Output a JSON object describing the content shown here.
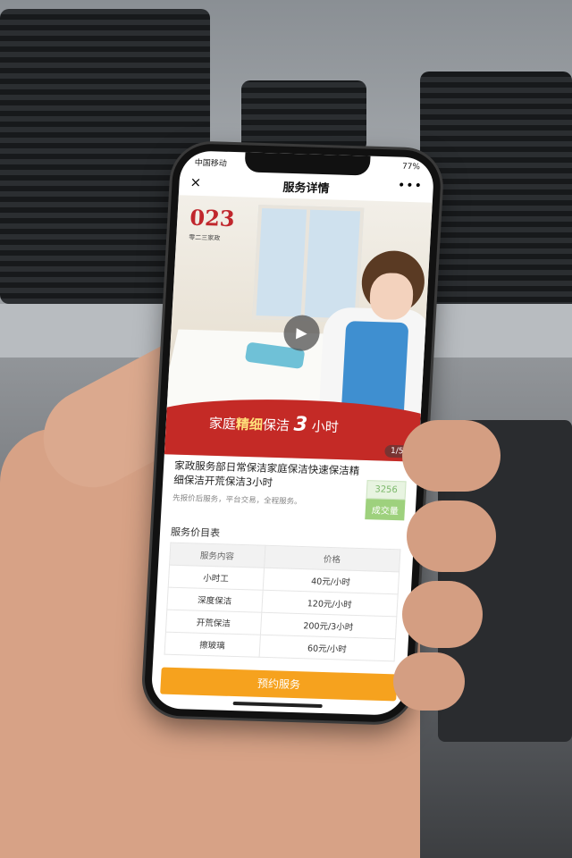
{
  "status_bar": {
    "carrier": "中国移动",
    "battery": "77%"
  },
  "nav": {
    "close_icon": "×",
    "title": "服务详情",
    "more_icon": "•••"
  },
  "banner": {
    "logo_text": "023",
    "logo_sub": "零二三家政",
    "slogan": {
      "part1": "家庭",
      "part2": "精细",
      "part3": "保洁",
      "hours_num": "3",
      "hours_unit": "小时"
    },
    "pager": "1/5"
  },
  "service": {
    "title": "家政服务部日常保洁家庭保洁快速保洁精细保洁开荒保洁3小时",
    "subtitle": "先报价后服务，平台交易，全程服务。",
    "sales_count": "3256",
    "sales_label": "成交量"
  },
  "price_list": {
    "heading": "服务价目表",
    "columns": [
      "服务内容",
      "价格"
    ],
    "rows": [
      {
        "item": "小时工",
        "price": "40元/小时"
      },
      {
        "item": "深度保洁",
        "price": "120元/小时"
      },
      {
        "item": "开荒保洁",
        "price": "200元/3小时"
      },
      {
        "item": "擦玻璃",
        "price": "60元/小时"
      }
    ]
  },
  "book_button": "预约服务",
  "colors": {
    "brand_red": "#c42a26",
    "button_orange": "#f6a21e",
    "sales_green": "#9ed17d"
  }
}
